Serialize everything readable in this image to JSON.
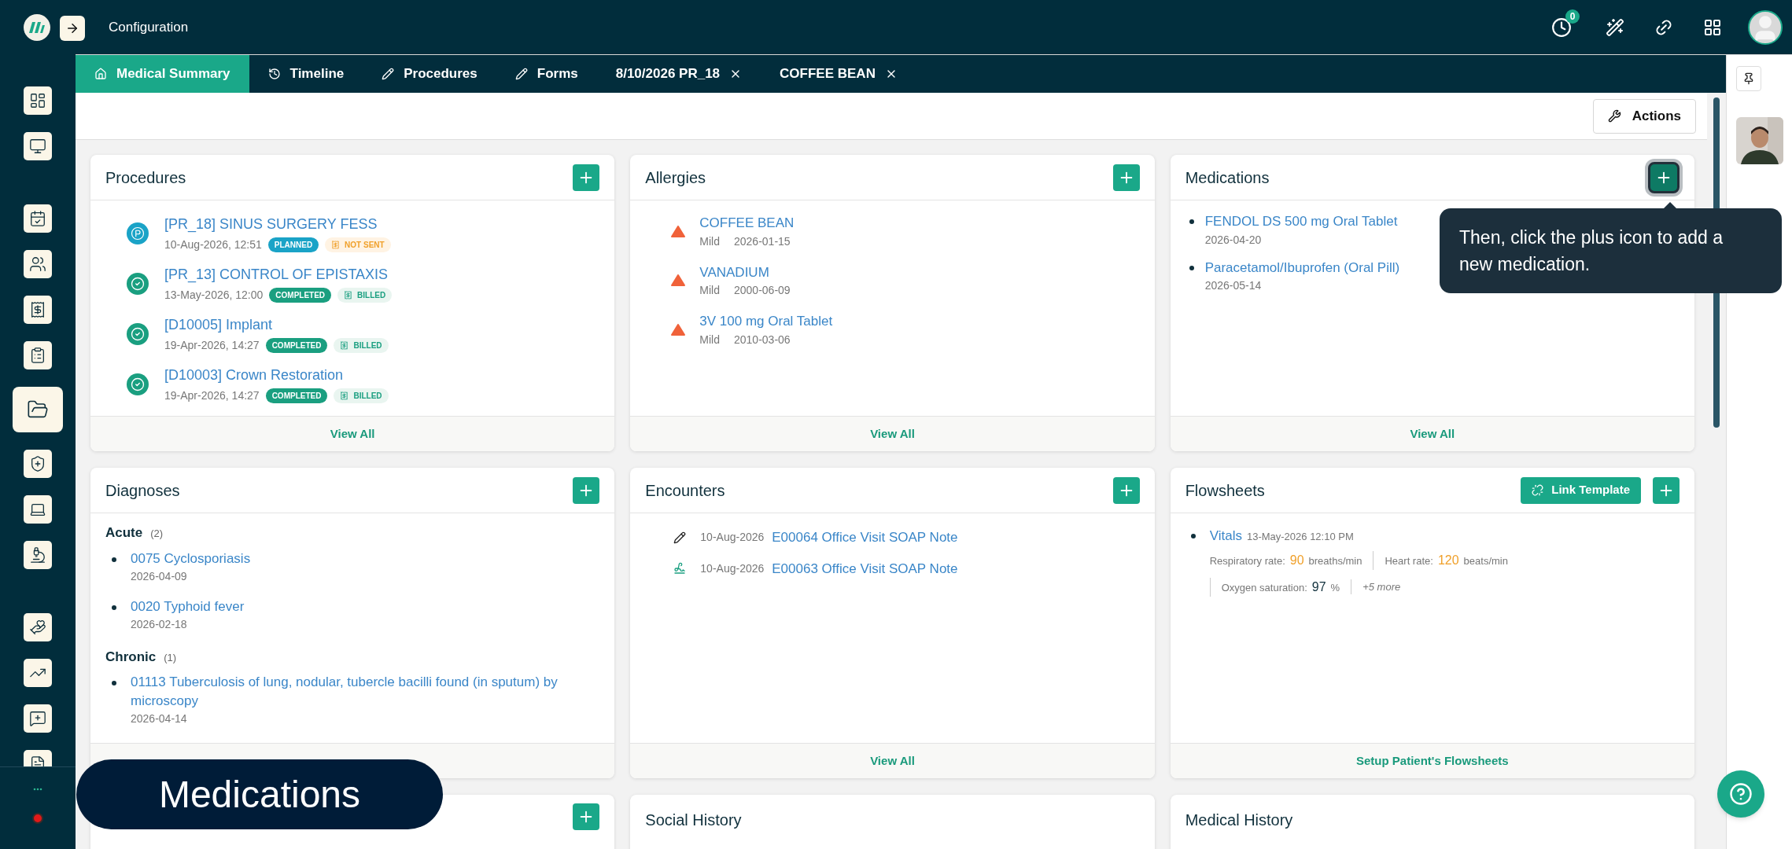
{
  "sidebar": {
    "items": [
      {
        "selected": false
      },
      {
        "selected": false
      },
      {
        "selected": false
      },
      {
        "selected": false
      },
      {
        "selected": false
      },
      {
        "selected": false
      },
      {
        "selected": true
      },
      {
        "selected": false
      },
      {
        "selected": false
      },
      {
        "selected": false
      },
      {
        "selected": false
      },
      {
        "selected": false
      },
      {
        "selected": false
      },
      {
        "selected": false
      }
    ],
    "recording": true
  },
  "header": {
    "title": "Configuration",
    "badge": "0"
  },
  "tabs": [
    {
      "label": "Medical Summary",
      "selected": true,
      "closable": false
    },
    {
      "label": "Timeline",
      "selected": false,
      "closable": false
    },
    {
      "label": "Procedures",
      "selected": false,
      "closable": false
    },
    {
      "label": "Forms",
      "selected": false,
      "closable": false
    },
    {
      "label": "8/10/2026 PR_18",
      "selected": false,
      "closable": true
    },
    {
      "label": "COFFEE BEAN",
      "selected": false,
      "closable": true
    }
  ],
  "toolbar": {
    "actions": "Actions"
  },
  "procedures": {
    "title": "Procedures",
    "footer": "View All",
    "items": [
      {
        "name": "[PR_18] SINUS SURGERY FESS",
        "datetime": "10-Aug-2026, 12:51",
        "status": "PLANNED",
        "completed": false,
        "billing": "NOT SENT",
        "billed": false
      },
      {
        "name": "[PR_13] CONTROL OF EPISTAXIS",
        "datetime": "13-May-2026, 12:00",
        "status": "COMPLETED",
        "completed": true,
        "billing": "BILLED",
        "billed": true
      },
      {
        "name": "[D10005] Implant",
        "datetime": "19-Apr-2026, 14:27",
        "status": "COMPLETED",
        "completed": true,
        "billing": "BILLED",
        "billed": true
      },
      {
        "name": "[D10003] Crown Restoration",
        "datetime": "19-Apr-2026, 14:27",
        "status": "COMPLETED",
        "completed": true,
        "billing": "BILLED",
        "billed": true
      }
    ]
  },
  "allergies": {
    "title": "Allergies",
    "footer": "View All",
    "items": [
      {
        "name": "COFFEE BEAN",
        "severity": "Mild",
        "date": "2026-01-15"
      },
      {
        "name": "VANADIUM",
        "severity": "Mild",
        "date": "2000-06-09"
      },
      {
        "name": "3V 100 mg Oral Tablet",
        "severity": "Mild",
        "date": "2010-03-06"
      }
    ]
  },
  "medications": {
    "title": "Medications",
    "footer": "View All",
    "add_highlighted": true,
    "items": [
      {
        "name": "FENDOL DS 500 mg Oral Tablet",
        "date": "2026-04-20"
      },
      {
        "name": "Paracetamol/Ibuprofen (Oral Pill)",
        "date": "2026-05-14"
      }
    ]
  },
  "diagnoses": {
    "title": "Diagnoses",
    "groups": [
      {
        "name": "Acute",
        "count": "(2)",
        "items": [
          {
            "name": "0075 Cyclosporiasis",
            "date": "2026-04-09"
          },
          {
            "name": "0020 Typhoid fever",
            "date": "2026-02-18"
          }
        ]
      },
      {
        "name": "Chronic",
        "count": "(1)",
        "items": [
          {
            "name": "01113 Tuberculosis of lung, nodular, tubercle bacilli found (in sputum) by microscopy",
            "date": "2026-04-14"
          }
        ]
      }
    ]
  },
  "encounters": {
    "title": "Encounters",
    "footer": "View All",
    "items": [
      {
        "kind": "pen",
        "date": "10-Aug-2026",
        "name": "E00064 Office Visit SOAP Note"
      },
      {
        "kind": "signature",
        "date": "10-Aug-2026",
        "name": "E00063 Office Visit SOAP Note"
      }
    ]
  },
  "flowsheets": {
    "title": "Flowsheets",
    "link_template": "Link Template",
    "footer": "Setup Patient's Flowsheets",
    "items": [
      {
        "name": "Vitals",
        "datetime": "13-May-2026 12:10 PM",
        "more": "+5 more",
        "readings": [
          {
            "label": "Respiratory rate:",
            "value": "90",
            "unit": "breaths/min",
            "kind": "alert"
          },
          {
            "label": "Heart rate:",
            "value": "120",
            "unit": "beats/min",
            "kind": "alert"
          },
          {
            "label": "Oxygen saturation:",
            "value": "97",
            "unit": "%",
            "kind": "normal"
          }
        ]
      }
    ]
  },
  "bottom_cards": [
    {
      "add_button": true
    },
    {
      "title": "Social History",
      "add_button": false
    },
    {
      "title": "Medical History",
      "add_button": false
    }
  ],
  "guide": {
    "tooltip": "Then, click the plus icon to add a new medication.",
    "caption": "Medications"
  }
}
